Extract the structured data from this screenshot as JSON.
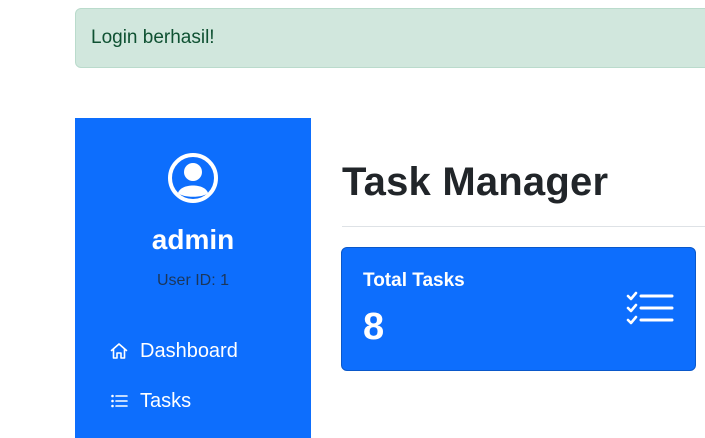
{
  "alert": {
    "message": "Login berhasil!"
  },
  "sidebar": {
    "avatar_icon": "person-circle-icon",
    "username": "admin",
    "user_id": "User ID: 1",
    "items": [
      {
        "label": "Dashboard",
        "icon": "house-icon"
      },
      {
        "label": "Tasks",
        "icon": "list-icon"
      }
    ]
  },
  "main": {
    "title": "Task Manager",
    "stat_card": {
      "label": "Total Tasks",
      "value": "8",
      "icon": "checklist-icon"
    }
  },
  "colors": {
    "primary": "#0d6efd",
    "success_bg": "#d1e7dd",
    "success_text": "#0f5132"
  }
}
